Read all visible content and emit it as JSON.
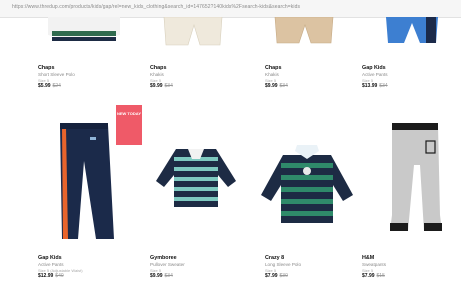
{
  "browser": {
    "url": "https://www.thredup.com/products/kids/gap/rel=new_kids_clothing&search_id=147652?140kids%2Fsearch-kids&search=kids"
  },
  "top_row": [
    {
      "brand": "Chaps",
      "name": "Short Sleeve Polo",
      "size": "Size 5",
      "price": "$5.99",
      "original": "$24"
    },
    {
      "brand": "Chaps",
      "name": "Khakis",
      "size": "Size 5",
      "price": "$9.99",
      "original": "$34"
    },
    {
      "brand": "Chaps",
      "name": "Khakis",
      "size": "Size 5",
      "price": "$9.99",
      "original": "$34"
    },
    {
      "brand": "Gap Kids",
      "name": "Active Pants",
      "size": "Size 5",
      "price": "$13.99",
      "original": "$34"
    }
  ],
  "bottom_row": [
    {
      "brand": "Gap Kids",
      "name": "Active Pants",
      "size": "Size 5 (Adjustable Waist)",
      "price": "$12.99",
      "original": "$40",
      "badge": "NEW TODAY"
    },
    {
      "brand": "Gymboree",
      "name": "Pullover Sweater",
      "size": "Size 5",
      "price": "$9.99",
      "original": "$34"
    },
    {
      "brand": "Crazy 8",
      "name": "Long Sleeve Polo",
      "size": "Size 5",
      "price": "$7.99",
      "original": "$30"
    },
    {
      "brand": "H&M",
      "name": "Sweatpants",
      "size": "Size 5",
      "price": "$7.99",
      "original": "$15"
    }
  ],
  "colors": {
    "navy": "#1b2a4a",
    "teal_green": "#2f8a6a",
    "orange_stripe": "#e8642c",
    "badge": "#ef5a68",
    "heather_gray": "#c9c9c9"
  }
}
